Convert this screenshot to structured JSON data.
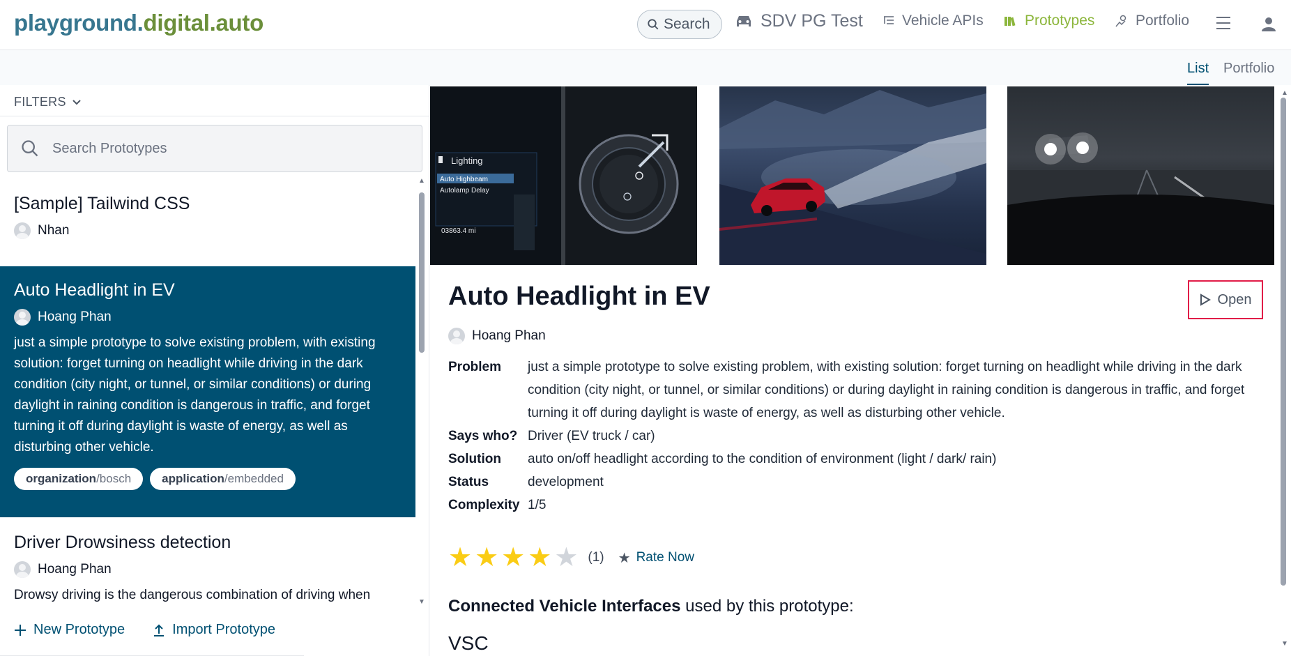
{
  "header": {
    "logo_main": "playground.",
    "logo_accent": "digital.auto",
    "search_label": "Search",
    "model_name": "SDV PG Test",
    "nav": {
      "vehicle_apis": "Vehicle APIs",
      "prototypes": "Prototypes",
      "portfolio": "Portfolio"
    }
  },
  "subtabs": {
    "list": "List",
    "portfolio": "Portfolio"
  },
  "sidebar": {
    "filters_label": "FILTERS",
    "search_placeholder": "Search Prototypes",
    "items": [
      {
        "title": "[Sample] Tailwind CSS",
        "author": "Nhan"
      },
      {
        "title": "Auto Headlight in EV",
        "author": "Hoang Phan",
        "description": "just a simple prototype to solve existing problem, with existing solution: forget turning on headlight while driving in the dark condition (city night, or tunnel, or similar conditions) or during daylight in raining condition is dangerous in traffic, and forget turning it off during daylight is waste of energy, as well as disturbing other vehicle.",
        "tags": [
          {
            "key": "organization",
            "value": "/bosch"
          },
          {
            "key": "application",
            "value": "/embedded"
          }
        ]
      },
      {
        "title": "Driver Drowsiness detection",
        "author": "Hoang Phan",
        "description": "Drowsy driving is the dangerous combination of driving when"
      }
    ],
    "new_prototype": "New Prototype",
    "import_prototype": "Import Prototype"
  },
  "detail": {
    "image_texts": {
      "lighting": "Lighting",
      "auto_highbeam": "Auto Highbeam",
      "autolamp_delay": "Autolamp Delay",
      "odometer": "03863.4 mi"
    },
    "title": "Auto Headlight in EV",
    "open_label": "Open",
    "author": "Hoang Phan",
    "fields": [
      {
        "key": "Problem",
        "value": "just a simple prototype to solve existing problem, with existing solution: forget turning on headlight while driving in the dark condition (city night, or tunnel, or similar conditions) or during daylight in raining condition is dangerous in traffic, and forget turning it off during daylight is waste of energy, as well as disturbing other vehicle."
      },
      {
        "key": "Says who?",
        "value": "Driver (EV truck / car)"
      },
      {
        "key": "Solution",
        "value": "auto on/off headlight according to the condition of environment (light / dark/ rain)"
      },
      {
        "key": "Status",
        "value": "development"
      },
      {
        "key": "Complexity",
        "value": "1/5"
      }
    ],
    "rating": {
      "stars": 4,
      "max": 5,
      "count": "(1)",
      "rate_now": "Rate Now"
    },
    "cvi_bold": "Connected Vehicle Interfaces",
    "cvi_rest": " used by this prototype:",
    "vsc": "VSC"
  },
  "colors": {
    "brand_teal": "#005072",
    "logo_blue": "#37768f",
    "logo_green": "#6b8f3a",
    "prototypes_active": "#8cb63c",
    "open_border": "#e11d48",
    "star": "#facc15"
  }
}
